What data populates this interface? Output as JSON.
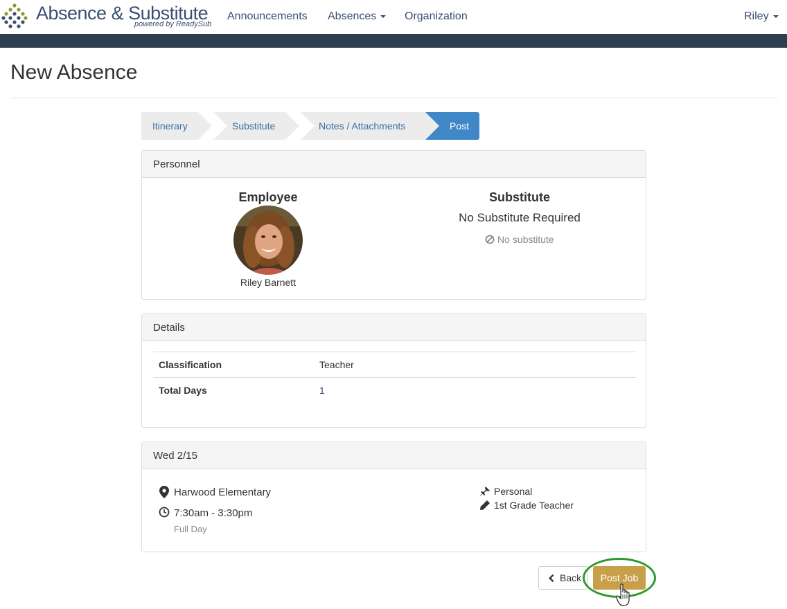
{
  "navbar": {
    "brand_title": "Absence & Substitute",
    "brand_sub": "powered by ReadySub",
    "links": [
      "Announcements",
      "Absences",
      "Organization"
    ],
    "user": "Riley"
  },
  "page": {
    "title": "New Absence"
  },
  "wizard": {
    "steps": [
      "Itinerary",
      "Substitute",
      "Notes / Attachments",
      "Post"
    ],
    "active_step": "Post"
  },
  "personnel": {
    "heading": "Personnel",
    "employee_title": "Employee",
    "employee_name": "Riley Barnett",
    "substitute_title": "Substitute",
    "substitute_status": "No Substitute Required",
    "no_substitute": "No substitute"
  },
  "details": {
    "heading": "Details",
    "rows": [
      {
        "label": "Classification",
        "value": "Teacher"
      },
      {
        "label": "Total Days",
        "value": "1"
      }
    ]
  },
  "day": {
    "heading": "Wed 2/15",
    "location": "Harwood Elementary",
    "time": "7:30am - 3:30pm",
    "duration": "Full Day",
    "reason": "Personal",
    "position": "1st Grade Teacher"
  },
  "actions": {
    "back": "Back",
    "post": "Post Job"
  },
  "colors": {
    "brand": "#3a4f72",
    "nav_dark": "#2d3e50",
    "active_step": "#3f87c7",
    "post_button": "#c9a04a",
    "highlight": "#2e9a2e"
  }
}
